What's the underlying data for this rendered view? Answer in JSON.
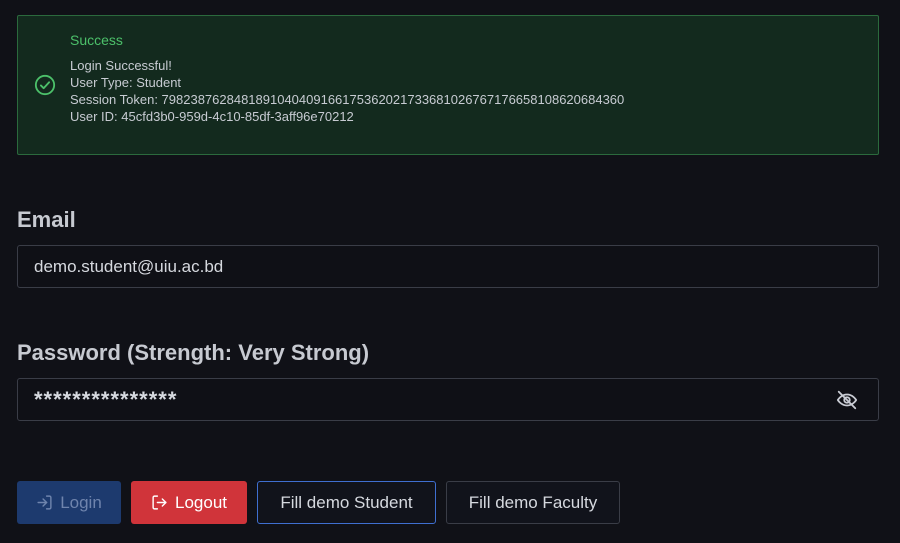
{
  "alert": {
    "title": "Success",
    "lines": [
      "Login Successful!",
      "User Type: Student",
      "Session Token: 7982387628481891040409166175362021733681026767176658108620684360",
      "User ID: 45cfd3b0-959d-4c10-85df-3aff96e70212"
    ],
    "icon": "check-circle-icon",
    "color": "#4cc06a"
  },
  "email": {
    "label": "Email",
    "value": "demo.student@uiu.ac.bd"
  },
  "password": {
    "label": "Password (Strength: Very Strong)",
    "value": "***************",
    "toggle_icon": "eye-off-icon"
  },
  "buttons": {
    "login": "Login",
    "logout": "Logout",
    "fill_student": "Fill demo Student",
    "fill_faculty": "Fill demo Faculty"
  },
  "colors": {
    "background": "#101117",
    "success": "#4cc06a",
    "danger": "#d0343a",
    "primary_disabled": "#1d3a6e",
    "focus_border": "#3f6fd0"
  }
}
